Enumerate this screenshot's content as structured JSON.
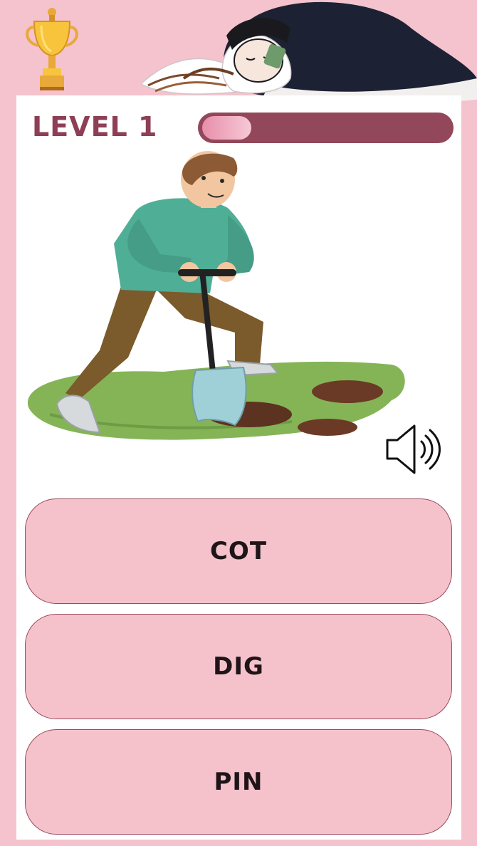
{
  "header": {
    "level_label": "LEVEL 1",
    "progress": 0.2,
    "trophy_icon": "trophy-icon",
    "mascot": "sleeping-girl-illustration"
  },
  "question": {
    "image": "man-digging-with-shovel-illustration",
    "sound_icon": "speaker-icon"
  },
  "answers": [
    {
      "label": "COT"
    },
    {
      "label": "DIG"
    },
    {
      "label": "PIN"
    }
  ],
  "colors": {
    "background": "#f5c3cd",
    "card": "#ffffff",
    "accent": "#93475a",
    "level_text": "#8e3f56",
    "answer_fill": "#f5c2cc",
    "answer_border": "#9b4a5e"
  }
}
